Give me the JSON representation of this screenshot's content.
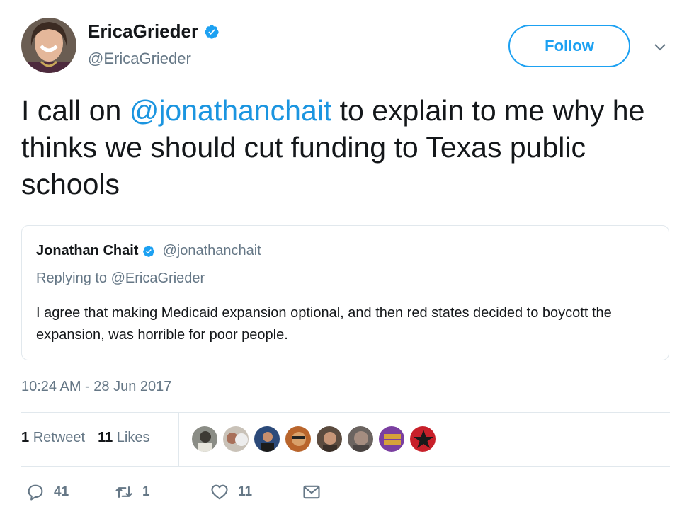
{
  "author": {
    "name": "EricaGrieder",
    "handle": "@EricaGrieder",
    "verified": true
  },
  "follow_label": "Follow",
  "tweet": {
    "text_before": "I call on ",
    "mention": "@jonathanchait",
    "text_after": " to explain to me why he thinks we should cut funding to Texas public schools"
  },
  "quoted_tweet": {
    "name": "Jonathan Chait",
    "handle": "@jonathanchait",
    "verified": true,
    "replying_to": "Replying to @EricaGrieder",
    "text": "I agree that making Medicaid expansion optional, and then red states decided to boycott the expansion, was horrible for poor people."
  },
  "timestamp": "10:24 AM - 28 Jun 2017",
  "stats": {
    "retweets_count": "1",
    "retweets_label": "Retweet",
    "likes_count": "11",
    "likes_label": "Likes"
  },
  "liker_avatar_count": 8,
  "actions": {
    "replies": "41",
    "retweets": "1",
    "likes": "11"
  },
  "colors": {
    "accent": "#1da1f2",
    "mention": "#1b95e0",
    "secondary_text": "#657786",
    "border": "#e1e8ed"
  },
  "icons": [
    "verified-badge-icon",
    "chevron-down-icon",
    "reply-icon",
    "retweet-icon",
    "heart-icon",
    "message-icon"
  ]
}
